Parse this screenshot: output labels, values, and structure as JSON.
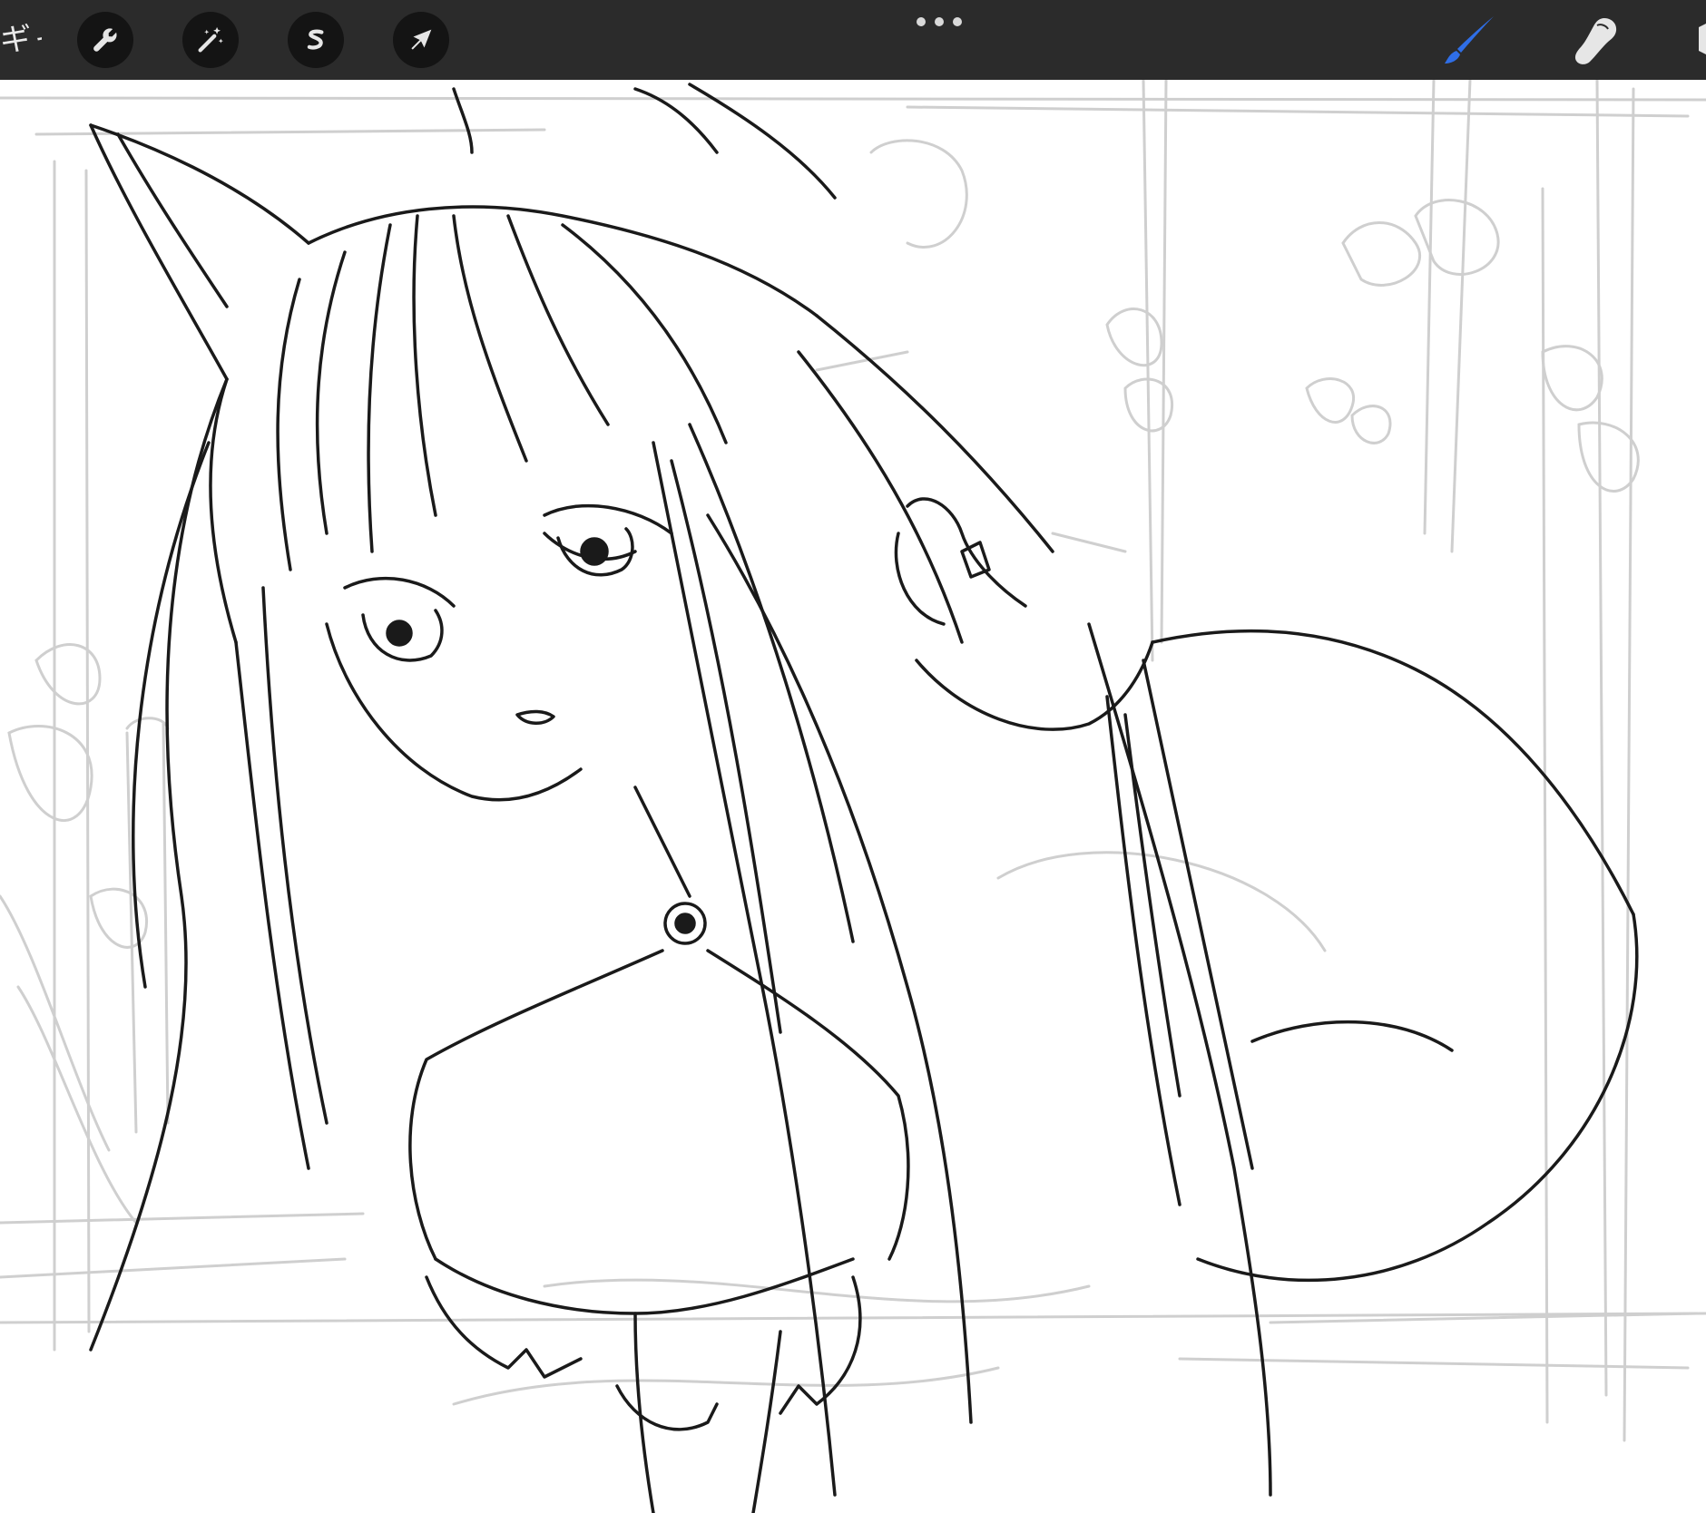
{
  "toolbar": {
    "gallery_label": "ギャラリー",
    "left_tools": [
      {
        "name": "actions",
        "icon": "wrench-icon"
      },
      {
        "name": "adjustments",
        "icon": "magic-wand-icon"
      },
      {
        "name": "selection",
        "icon": "selection-s-icon"
      },
      {
        "name": "transform",
        "icon": "arrow-cursor-icon"
      }
    ],
    "more_icon": "more-dots-icon",
    "right_tools": [
      {
        "name": "brush",
        "icon": "brush-icon",
        "active": true
      },
      {
        "name": "smudge",
        "icon": "smudge-finger-icon",
        "active": false
      },
      {
        "name": "eraser",
        "icon": "eraser-icon",
        "active": false
      }
    ]
  },
  "colors": {
    "toolbar_bg": "#2b2b2b",
    "tool_button_bg": "#141414",
    "active_tool": "#2f6ee6",
    "icon_light": "#e6e6e6",
    "sketch_line": "#1a1a1a",
    "rough_line": "#c9c9c9",
    "canvas_bg": "#ffffff"
  },
  "canvas": {
    "content": "line-art-sketch-fox-eared-girl"
  }
}
